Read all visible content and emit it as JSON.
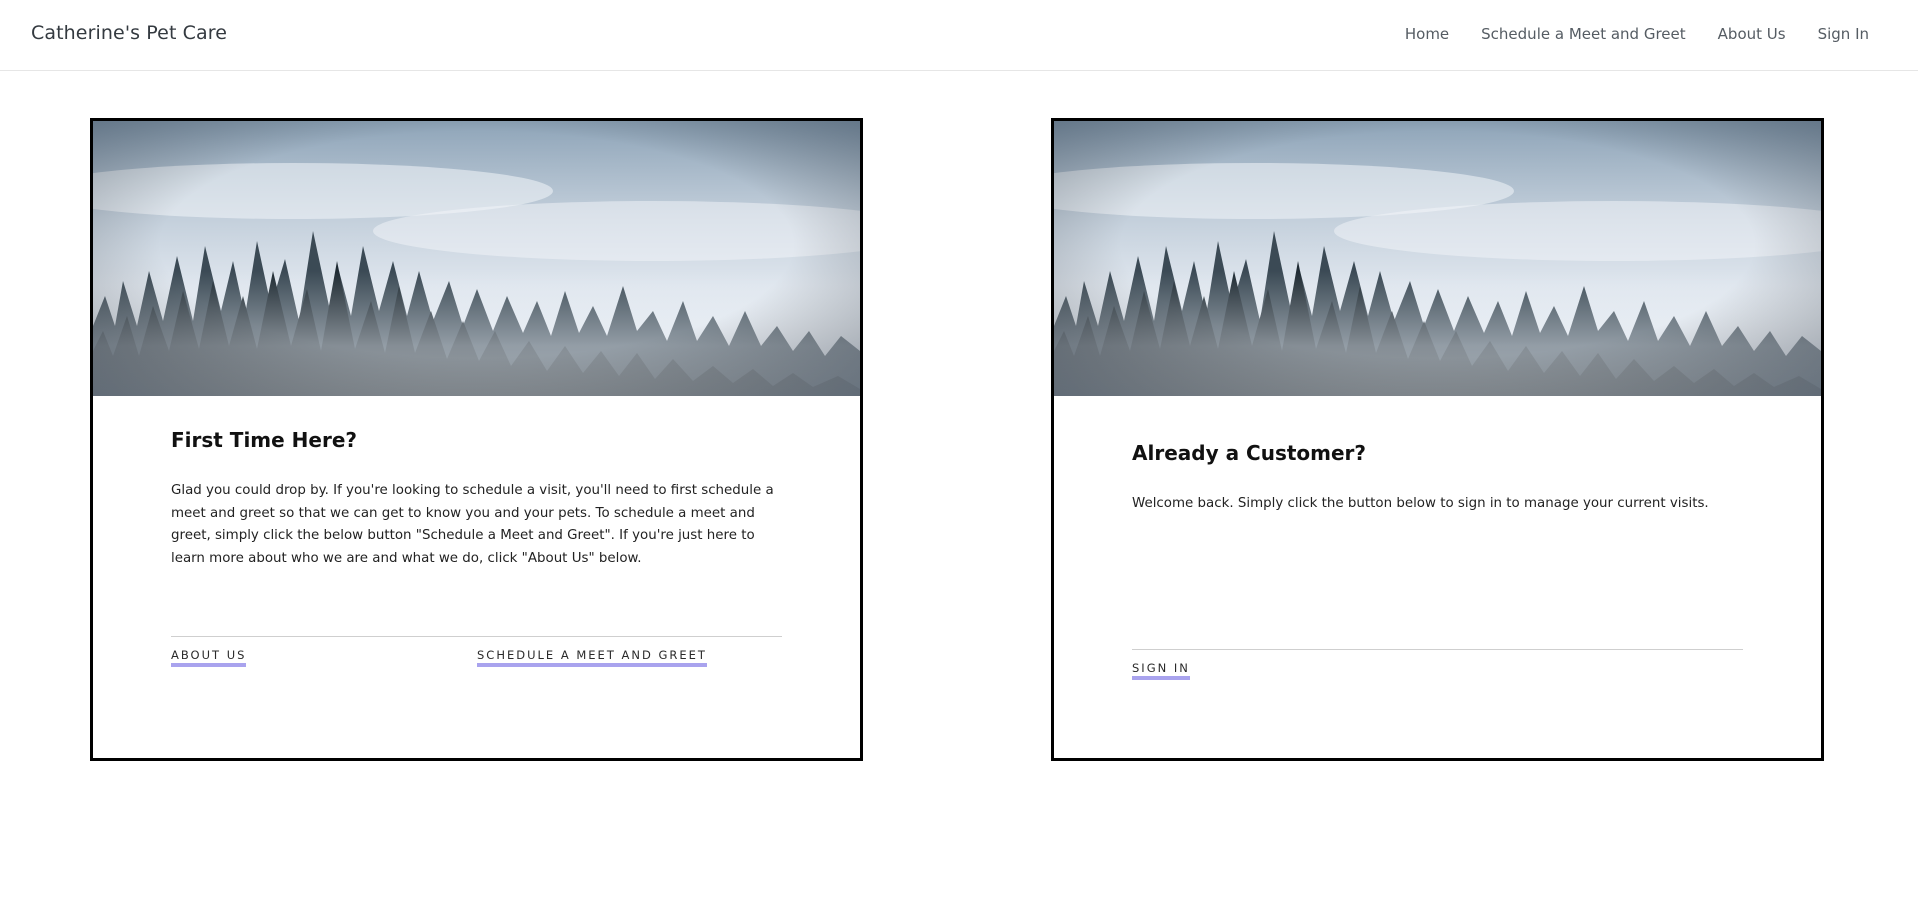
{
  "navbar": {
    "brand": "Catherine's Pet Care",
    "links": [
      {
        "label": "Home"
      },
      {
        "label": "Schedule a Meet and Greet"
      },
      {
        "label": "About Us"
      },
      {
        "label": "Sign In"
      }
    ]
  },
  "cards": [
    {
      "title": "First Time Here?",
      "text": "Glad you could drop by. If you're looking to schedule a visit, you'll need to first schedule a meet and greet so that we can get to know you and your pets. To schedule a meet and greet, simply click the below button \"Schedule a Meet and Greet\". If you're just here to learn more about who we are and what we do, click \"About Us\" below.",
      "actions": [
        {
          "label": "ABOUT US"
        },
        {
          "label": "SCHEDULE A MEET AND GREET"
        }
      ]
    },
    {
      "title": "Already a Customer?",
      "text": "Welcome back. Simply click the button below to sign in to manage your current visits.",
      "actions": [
        {
          "label": "SIGN IN"
        }
      ]
    }
  ],
  "colors": {
    "nav_text": "#555c63",
    "brand_text": "#343a40",
    "link_underline": "#a9a3ee",
    "card_border": "#000000"
  },
  "images": {
    "hero": "misty-pine-forest-image"
  }
}
